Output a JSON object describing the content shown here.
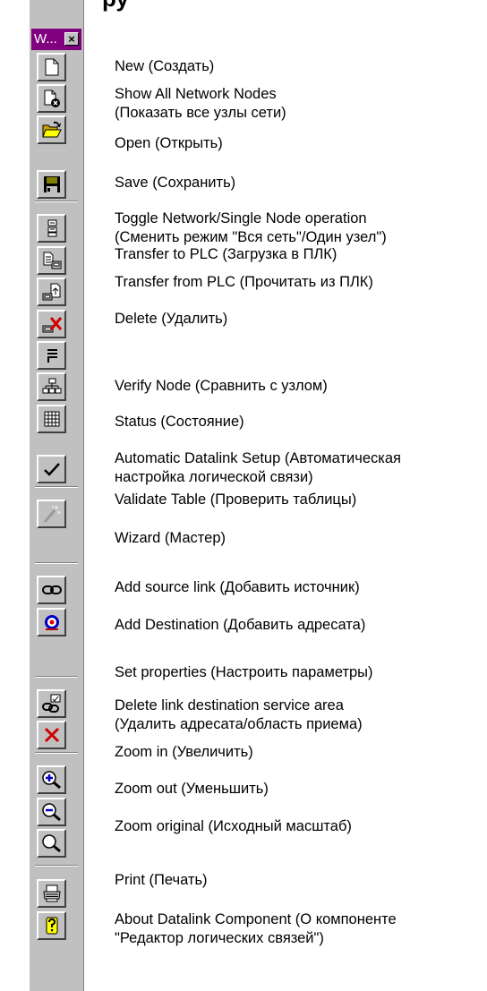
{
  "page": {
    "heading_fragment": "ру"
  },
  "toolbar": {
    "title": "W...",
    "close_glyph": "×",
    "buttons": [
      {
        "id": "new",
        "icon": "new-document-icon"
      },
      {
        "id": "show-all-nodes",
        "icon": "show-network-nodes-icon"
      },
      {
        "id": "open",
        "icon": "open-folder-icon"
      },
      {
        "id": "save",
        "icon": "floppy-disk-icon"
      },
      {
        "id": "toggle-network",
        "icon": "network-node-toggle-icon"
      },
      {
        "id": "transfer-to-plc",
        "icon": "transfer-to-plc-icon"
      },
      {
        "id": "transfer-from-plc",
        "icon": "transfer-from-plc-icon"
      },
      {
        "id": "delete",
        "icon": "delete-link-icon"
      },
      {
        "id": "verify-node",
        "icon": "verify-node-icon"
      },
      {
        "id": "status",
        "icon": "status-network-icon"
      },
      {
        "id": "auto-setup",
        "icon": "automatic-setup-grid-icon"
      },
      {
        "id": "validate-table",
        "icon": "checkmark-icon"
      },
      {
        "id": "wizard",
        "icon": "wizard-wand-icon",
        "disabled": true
      },
      {
        "id": "add-source-link",
        "icon": "chain-link-icon"
      },
      {
        "id": "add-destination",
        "icon": "destination-target-icon"
      },
      {
        "id": "set-properties",
        "icon": "link-properties-icon"
      },
      {
        "id": "delete-destination",
        "icon": "red-x-icon"
      },
      {
        "id": "zoom-in",
        "icon": "zoom-in-icon"
      },
      {
        "id": "zoom-out",
        "icon": "zoom-out-icon"
      },
      {
        "id": "zoom-original",
        "icon": "zoom-original-icon"
      },
      {
        "id": "print",
        "icon": "printer-icon"
      },
      {
        "id": "about",
        "icon": "question-mark-icon"
      }
    ]
  },
  "items": [
    {
      "text": "New (Создать)"
    },
    {
      "text": "Show All Network Nodes\n(Показать все узлы сети)"
    },
    {
      "text": "Open (Открыть)"
    },
    {
      "text": "Save (Сохранить)"
    },
    {
      "text": "Toggle Network/Single Node operation\n(Сменить режим \"Вся сеть\"/Один узел\")"
    },
    {
      "text": "Transfer to PLC (Загрузка в ПЛК)"
    },
    {
      "text": "Transfer from PLC (Прочитать из ПЛК)"
    },
    {
      "text": "Delete (Удалить)"
    },
    {
      "text": "Verify Node (Сравнить с узлом)"
    },
    {
      "text": "Status (Состояние)"
    },
    {
      "text": "Automatic Datalink Setup (Автоматическая\nнастройка логической связи)"
    },
    {
      "text": "Validate Table (Проверить таблицы)"
    },
    {
      "text": "Wizard (Мастер)"
    },
    {
      "text": "Add source link (Добавить источник)"
    },
    {
      "text": "Add Destination (Добавить адресата)"
    },
    {
      "text": "Set properties (Настроить параметры)"
    },
    {
      "text": "Delete link destination service area\n(Удалить адресата/область приема)"
    },
    {
      "text": "Zoom in (Увеличить)"
    },
    {
      "text": "Zoom out (Уменьшить)"
    },
    {
      "text": "Zoom original (Исходный масштаб)"
    },
    {
      "text": "Print (Печать)"
    },
    {
      "text": "About Datalink Component (О компоненте\n\"Редактор логических связей\")"
    }
  ]
}
